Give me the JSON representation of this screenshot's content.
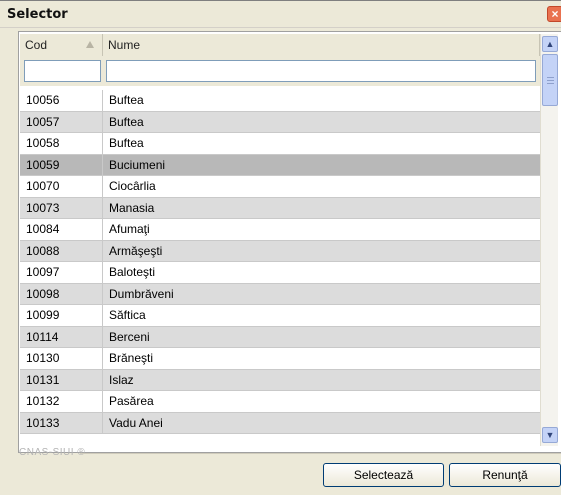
{
  "window": {
    "title": "Selector",
    "close_glyph": "×"
  },
  "grid": {
    "columns": [
      {
        "label": "Cod",
        "sort": "ascending"
      },
      {
        "label": "Nume"
      }
    ],
    "filters": {
      "cod": "",
      "nume": ""
    },
    "rows": [
      {
        "cod": "10056",
        "nume": "Buftea"
      },
      {
        "cod": "10057",
        "nume": "Buftea"
      },
      {
        "cod": "10058",
        "nume": "Buftea"
      },
      {
        "cod": "10059",
        "nume": "Buciumeni"
      },
      {
        "cod": "10070",
        "nume": "Ciocârlia"
      },
      {
        "cod": "10073",
        "nume": "Manasia"
      },
      {
        "cod": "10084",
        "nume": "Afumaţi"
      },
      {
        "cod": "10088",
        "nume": "Armăşeşti"
      },
      {
        "cod": "10097",
        "nume": "Baloteşti"
      },
      {
        "cod": "10098",
        "nume": "Dumbrăveni"
      },
      {
        "cod": "10099",
        "nume": "Săftica"
      },
      {
        "cod": "10114",
        "nume": "Berceni"
      },
      {
        "cod": "10130",
        "nume": "Brăneşti"
      },
      {
        "cod": "10131",
        "nume": "Islaz"
      },
      {
        "cod": "10132",
        "nume": "Pasărea"
      },
      {
        "cod": "10133",
        "nume": "Vadu Anei"
      }
    ],
    "selected_index": 3
  },
  "scrollbar": {
    "up_glyph": "▲",
    "down_glyph": "▼"
  },
  "footer": {
    "watermark": "CNAS-SIUI ®",
    "select_label": "Selectează",
    "cancel_label": "Renunţă"
  }
}
